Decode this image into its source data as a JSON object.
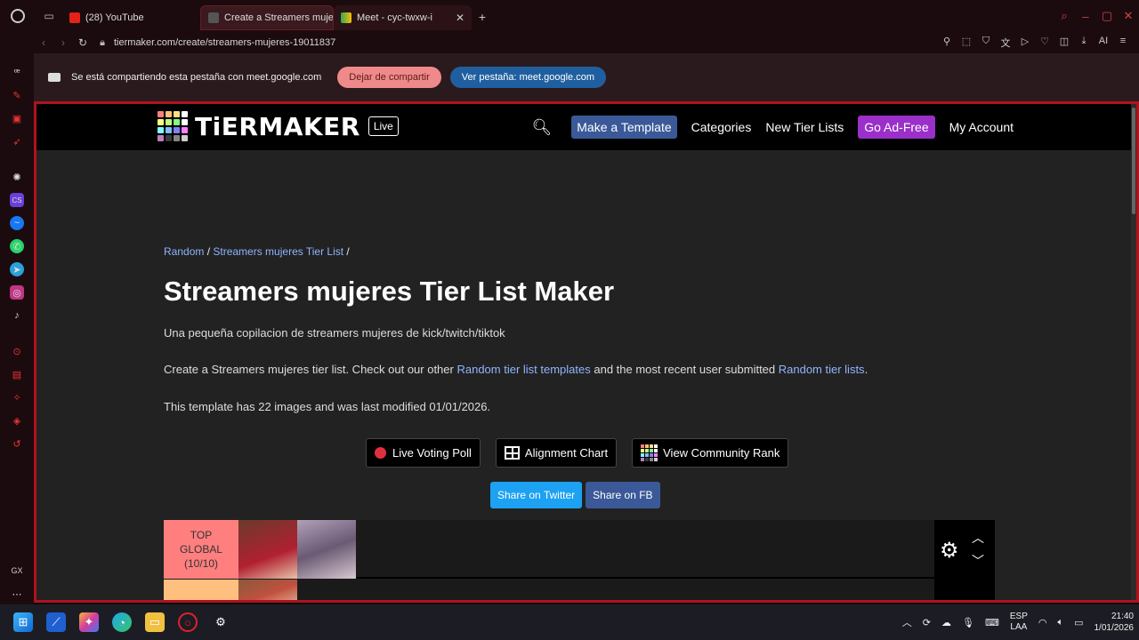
{
  "browser": {
    "tabs": [
      {
        "label": "(28) YouTube"
      },
      {
        "label": "Create a Streamers mujer"
      },
      {
        "label": "Meet - cyc-twxw-i"
      }
    ],
    "url": "tiermaker.com/create/streamers-mujeres-19011837",
    "ai_label": "AI",
    "gx_label": "GX"
  },
  "sharebar": {
    "text": "Se está compartiendo esta pestaña con meet.google.com",
    "stop_label": "Dejar de compartir",
    "view_label": "Ver pestaña: meet.google.com"
  },
  "header": {
    "logo": "TiERMAKER",
    "live": "Live",
    "make_template": "Make a Template",
    "categories": "Categories",
    "new_tier_lists": "New Tier Lists",
    "go_ad_free": "Go Ad-Free",
    "my_account": "My Account"
  },
  "main": {
    "crumb_random": "Random",
    "crumb_sep1": " / ",
    "crumb_list": "Streamers mujeres Tier List",
    "crumb_sep2": " /",
    "title": "Streamers mujeres Tier List Maker",
    "description": "Una pequeña copilacion de streamers mujeres de kick/twitch/tiktok",
    "blurb_1": "Create a Streamers mujeres tier list. Check out our other ",
    "blurb_link1": "Random tier list templates",
    "blurb_2": " and the most recent user submitted ",
    "blurb_link2": "Random tier lists",
    "blurb_3": ".",
    "count": "This template has 22 images and was last modified 01/01/2026."
  },
  "actions": {
    "live_poll": "Live Voting Poll",
    "alignment": "Alignment Chart",
    "community": "View Community Rank"
  },
  "share": {
    "twitter": "Share on Twitter",
    "fb": "Share on FB"
  },
  "tier": {
    "top_label_1": "TOP",
    "top_label_2": "GLOBAL",
    "top_label_3": "(10/10)"
  },
  "taskbar": {
    "lang_1": "ESP",
    "lang_2": "LAA",
    "time": "21:40",
    "date": "1/01/2026"
  },
  "colors": {
    "accent_red": "#b0121e",
    "link": "#8fb4ff",
    "template_btn": "#3b5998",
    "adfree_btn": "#9b2fc9",
    "tier_top": "#ff7f7f"
  }
}
